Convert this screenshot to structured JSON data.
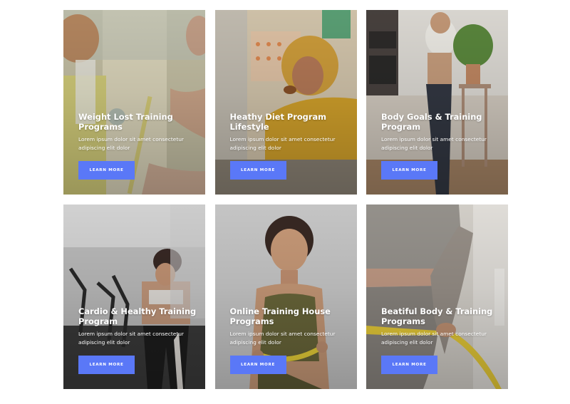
{
  "cards": [
    {
      "title": "Weight Lost Training Programs",
      "text": "Lorem ipsum dolor sit amet consectetur adipiscing elit dolor",
      "button": "LEARN MORE",
      "photo": "woman-measuring-waist",
      "colors": {
        "bg": "#cfc8a6",
        "accent": "#d9d07a"
      }
    },
    {
      "title": "Heathy Diet Program Lifestyle",
      "text": "Lorem ipsum dolor sit amet consectetur adipiscing elit dolor",
      "button": "LEARN MORE",
      "photo": "woman-eating-in-kitchen",
      "colors": {
        "bg": "#d9c7a0",
        "accent": "#d8a632"
      }
    },
    {
      "title": "Body Goals & Training Program",
      "text": "Lorem ipsum dolor sit amet consectetur adipiscing elit dolor",
      "button": "LEARN MORE",
      "photo": "woman-in-sportswear-home",
      "colors": {
        "bg": "#d8d3cc",
        "accent": "#343944"
      }
    },
    {
      "title": "Cardio & Healthy Training Program",
      "text": "Lorem ipsum dolor sit amet consectetur adipiscing elit dolor",
      "button": "LEARN MORE",
      "photo": "woman-in-gym",
      "colors": {
        "bg": "#b9b9b9",
        "accent": "#1e1e1e"
      }
    },
    {
      "title": "Online Training House Programs",
      "text": "Lorem ipsum dolor sit amet consectetur adipiscing elit dolor",
      "button": "LEARN MORE",
      "photo": "woman-with-measuring-tape",
      "colors": {
        "bg": "#c7c7c7",
        "accent": "#6d6a3c"
      }
    },
    {
      "title": "Beatiful Body & Training Programs",
      "text": "Lorem ipsum dolor sit amet consectetur adipiscing elit dolor",
      "button": "LEARN MORE",
      "photo": "waist-with-measuring-tape",
      "colors": {
        "bg": "#d9d5cf",
        "accent": "#9d958d"
      }
    }
  ],
  "button_color": "#5a78f7"
}
